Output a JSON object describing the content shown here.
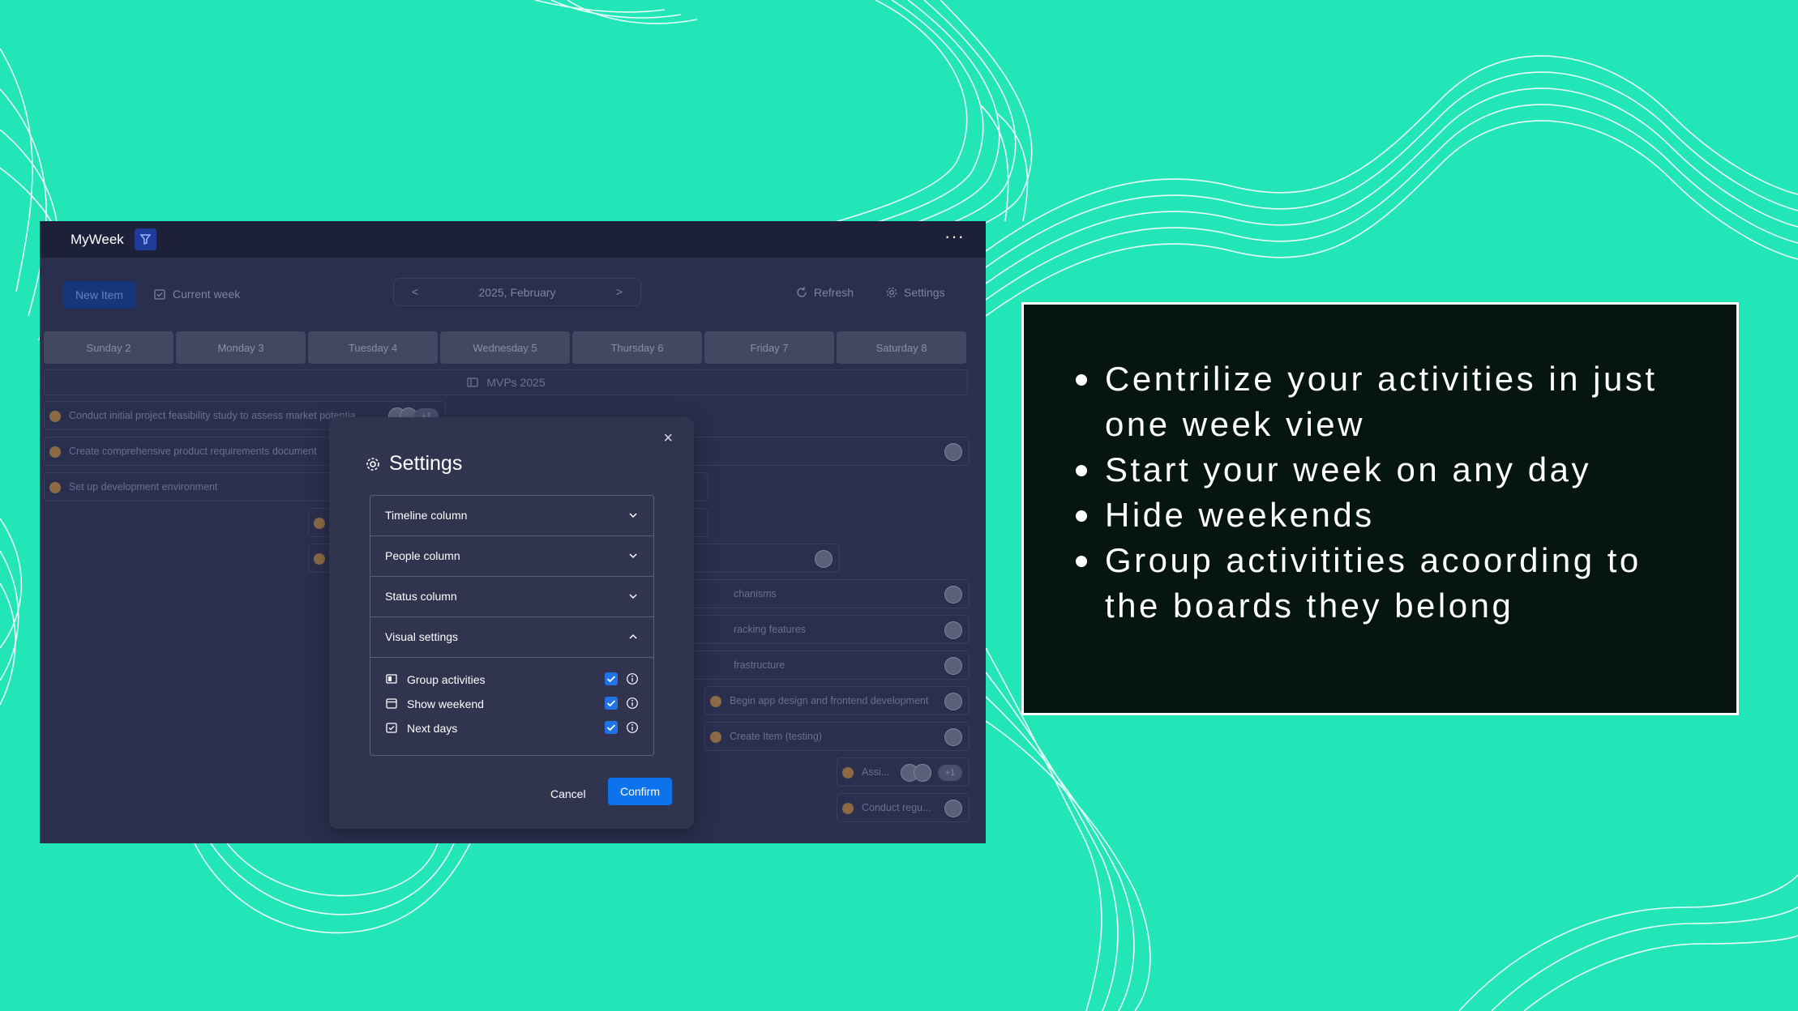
{
  "colors": {
    "background": "#22e5b8",
    "app_background": "#2a2f4e",
    "titlebar": "#1c2039",
    "modal": "#30344f",
    "primary_button": "#0d73ec",
    "checkbox": "#1f73e6",
    "feature_box": "#061510"
  },
  "app": {
    "title": "MyWeek",
    "filter_icon": "filter-icon",
    "more_icon": "more-horizontal-icon",
    "more_label": "···"
  },
  "toolbar": {
    "new_item": "New Item",
    "current_week": "Current week",
    "date_label": "2025, February",
    "prev": "<",
    "next": ">",
    "refresh": "Refresh",
    "settings": "Settings"
  },
  "days": [
    "Sunday 2",
    "Monday 3",
    "Tuesday 4",
    "Wednesday 5",
    "Thursday 6",
    "Friday 7",
    "Saturday 8"
  ],
  "group": {
    "label": "MVPs 2025"
  },
  "tasks": {
    "t1": "Conduct initial project feasibility study to assess market potentia",
    "t1_more": "+1",
    "t2": "Create comprehensive product requirements document",
    "t3": "Set up development environment",
    "t4": "chanisms",
    "t5": "racking features",
    "t6": "frastructure",
    "t7": "Begin app design and frontend development",
    "t8": "Create Item (testing)",
    "t9": "Assi...",
    "t9_more": "+1",
    "t10": "Conduct regu..."
  },
  "modal": {
    "title": "Settings",
    "close": "×",
    "sections": {
      "timeline": "Timeline column",
      "people": "People column",
      "status": "Status column",
      "visual": "Visual settings"
    },
    "options": {
      "group_activities": "Group activities",
      "show_weekend": "Show weekend",
      "next_days": "Next days"
    },
    "cancel": "Cancel",
    "confirm": "Confirm"
  },
  "features": [
    "Centrilize your activities in just one week view",
    "Start your week on any day",
    "Hide weekends",
    "Group activitities acoording to the boards they belong"
  ]
}
